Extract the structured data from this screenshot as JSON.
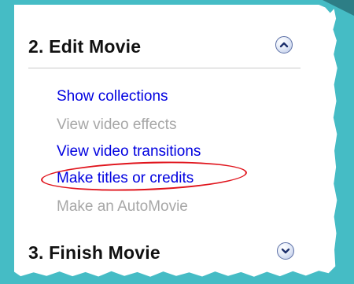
{
  "accent_colors": {
    "background": "#45bcc5",
    "link": "#0000e0",
    "disabled": "#a7a7a7",
    "highlight": "#e0141c"
  },
  "panel": {
    "edit_section": {
      "title": "2. Edit Movie",
      "toggle_icon": "chevron-up-icon",
      "tasks": [
        {
          "label": "Show collections",
          "enabled": true
        },
        {
          "label": "View video effects",
          "enabled": false
        },
        {
          "label": "View video transitions",
          "enabled": true
        },
        {
          "label": "Make titles or credits",
          "enabled": true,
          "highlighted": true
        },
        {
          "label": "Make an AutoMovie",
          "enabled": false
        }
      ]
    },
    "finish_section": {
      "title": "3. Finish Movie",
      "toggle_icon": "chevron-down-icon"
    }
  }
}
